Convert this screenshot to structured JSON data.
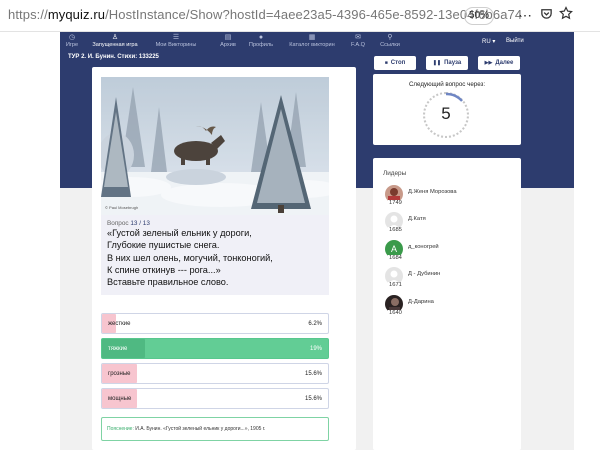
{
  "browser": {
    "url_prefix": "https://",
    "url_host": "myquiz.ru",
    "url_path": "/HostInstance/Show?hostId=4aee23a5-4396-465e-8592-13e04f6b6a74",
    "zoom": "50%",
    "icons": [
      "more-icon",
      "pocket-icon",
      "star-icon"
    ]
  },
  "nav": {
    "items": [
      {
        "label": "Игре",
        "icon": "clock-icon"
      },
      {
        "label": "Запущенная игра",
        "icon": "flask-icon",
        "active": true
      },
      {
        "label": "Мои Викторины",
        "icon": "list-icon"
      },
      {
        "label": "Архив",
        "icon": "archive-icon"
      },
      {
        "label": "Профиль",
        "icon": "user-icon"
      },
      {
        "label": "Каталог викторин",
        "icon": "catalog-icon"
      },
      {
        "label": "F.A.Q",
        "icon": "chat-icon"
      },
      {
        "label": "Ссылки",
        "icon": "link-icon"
      }
    ],
    "lang": "RU",
    "logout": "Выйти"
  },
  "tour_title": "ТУР 2. И. Бунин. Стихи: 133225",
  "controls": {
    "stop": "Стоп",
    "pause": "Пауза",
    "next": "Далее"
  },
  "question": {
    "label": "Вопрос",
    "number": "13 / 13",
    "lines": [
      "«Густой зеленый ельник у дороги,",
      "Глубокие пушистые снега.",
      "В них шел олень, могучий, тонконогий,",
      "К спине откинув --- рога...»",
      "Вставьте правильное слово."
    ],
    "photo_caption": "© Paul Mosebrugh"
  },
  "answers": [
    {
      "label": "жесткие",
      "percent": "6.2%",
      "fraction": 0.062,
      "correct": false
    },
    {
      "label": "тяжкие",
      "percent": "19%",
      "fraction": 0.19,
      "correct": true
    },
    {
      "label": "грозные",
      "percent": "15.6%",
      "fraction": 0.156,
      "correct": false
    },
    {
      "label": "мощные",
      "percent": "15.6%",
      "fraction": 0.156,
      "correct": false
    }
  ],
  "explanation": {
    "label": "Пояснение:",
    "text": "И.А. Бунин. «Густой зеленый ельник у дороги...», 1905 г."
  },
  "timer": {
    "label": "Следующий вопрос через:",
    "value": "5"
  },
  "leaders": {
    "title": "Лидеры",
    "items": [
      {
        "name": "Д.Женя Морозова",
        "score": "1749",
        "avatar": "photo"
      },
      {
        "name": "Д.Катя",
        "score": "1685",
        "avatar": "default"
      },
      {
        "name": "д_коногрей",
        "score": "1684",
        "avatar": "letter",
        "letter": "А"
      },
      {
        "name": "Д - Дубинин",
        "score": "1671",
        "avatar": "default"
      },
      {
        "name": "Д-Дарина",
        "score": "1640",
        "avatar": "photo-dark"
      }
    ]
  },
  "colors": {
    "navbar": "#2d3c6e",
    "correct": "#62cd95",
    "wrong_fill": "#f7c5cf",
    "green_avatar": "#3a9a4a"
  }
}
